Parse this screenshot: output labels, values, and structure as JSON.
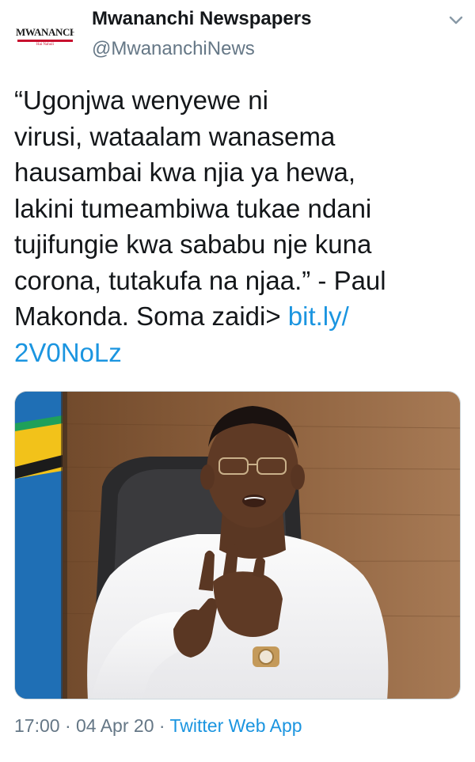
{
  "account": {
    "display_name": "Mwananchi Newspapers",
    "handle": "@MwananchiNews",
    "avatar_logo_text": "MWANANCHI",
    "avatar_logo_subtext": "Hai Nahuli"
  },
  "tweet": {
    "text_lines": [
      "“Ugonjwa wenyewe ni",
      "virusi, wataalam wanasema",
      "hausambai kwa njia ya hewa,",
      "lakini tumeambiwa tukae ndani",
      "tujifungie kwa sababu nje kuna",
      "corona, tutakufa na njaa.” - Paul",
      "Makonda. Soma zaidi> "
    ],
    "link_part1": "bit.ly/",
    "link_part2": "2V0NoLz"
  },
  "media": {
    "icon": "photo-of-man-in-white-tshirt-gesturing"
  },
  "footer": {
    "time": "17:00",
    "separator": " · ",
    "date": "04 Apr 20",
    "source": "Twitter Web App"
  },
  "colors": {
    "link": "#1b95e0",
    "secondary_text": "#657786",
    "primary_text": "#14171a"
  },
  "icons": {
    "menu": "chevron-down-icon"
  }
}
